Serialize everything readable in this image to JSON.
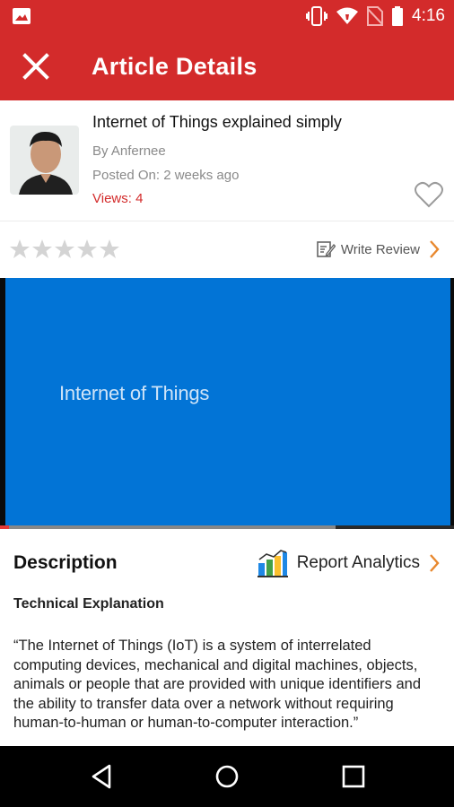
{
  "status_bar": {
    "time": "4:16",
    "icons": [
      "image-icon",
      "vibrate-icon",
      "wifi-icon",
      "no-sim-icon",
      "battery-icon"
    ]
  },
  "app_bar": {
    "title": "Article Details",
    "close_icon": "close-icon"
  },
  "article": {
    "title": "Internet of Things explained simply",
    "author": "By Anfernee",
    "posted": "Posted On: 2 weeks ago",
    "views": "Views: 4"
  },
  "rating": {
    "stars_filled": 0,
    "stars_total": 5,
    "write_review_label": "Write Review"
  },
  "video": {
    "title_text": "Internet of Things",
    "progress_played": 0.02,
    "progress_buffered": 0.74
  },
  "description": {
    "heading": "Description",
    "report_label": "Report Analytics",
    "subheading": "Technical Explanation",
    "body": "“The Internet of Things (IoT) is a system of interrelated computing devices, mechanical and digital machines, objects, animals or people that are provided with unique identifiers and the ability to transfer data over a network without requiring human-to-human or human-to-computer interaction.”"
  },
  "colors": {
    "brand": "#d32b2b",
    "video_bg": "#0274d6",
    "accent_arrow": "#e8882e"
  },
  "nav": [
    "back-icon",
    "home-icon",
    "recents-icon"
  ]
}
